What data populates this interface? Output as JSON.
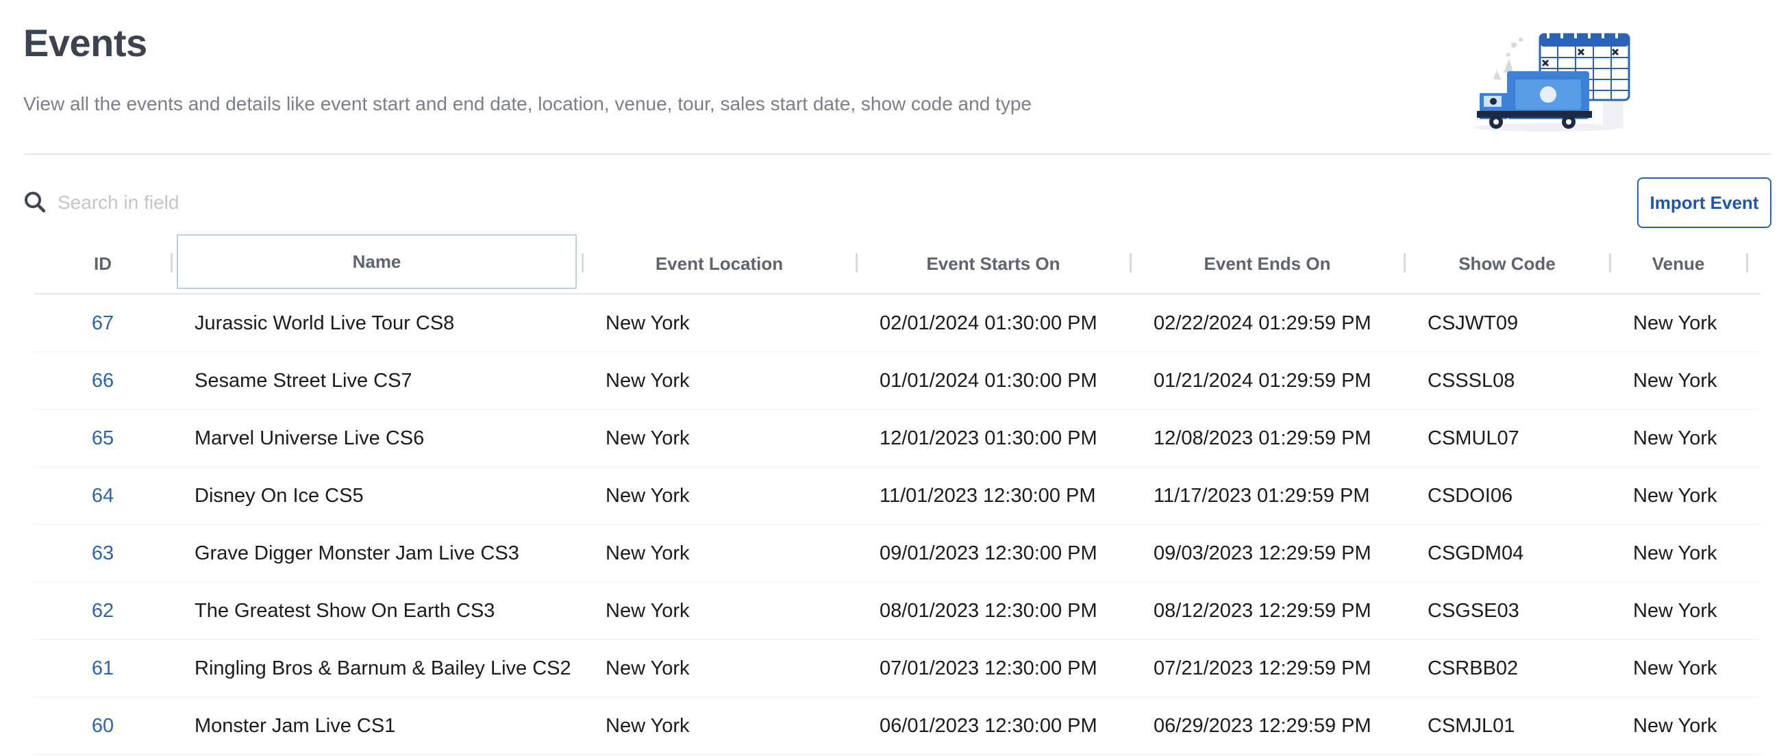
{
  "header": {
    "title": "Events",
    "subtitle": "View all the events and details like event start and end date, location, venue, tour, sales start date, show code and type"
  },
  "search": {
    "placeholder": "Search in field",
    "value": ""
  },
  "toolbar": {
    "import_label": "Import Event"
  },
  "colors": {
    "accent": "#2563b8",
    "link": "#2a62b4",
    "heading": "#3c4350"
  },
  "table": {
    "columns": [
      "ID",
      "Name",
      "Event Location",
      "Event Starts On",
      "Event Ends On",
      "Show Code",
      "Venue"
    ],
    "rows": [
      [
        "67",
        "Jurassic World Live Tour CS8",
        "New York",
        "02/01/2024 01:30:00 PM",
        "02/22/2024 01:29:59 PM",
        "CSJWT09",
        "New York"
      ],
      [
        "66",
        "Sesame Street Live CS7",
        "New York",
        "01/01/2024 01:30:00 PM",
        "01/21/2024 01:29:59 PM",
        "CSSSL08",
        "New York"
      ],
      [
        "65",
        "Marvel Universe Live CS6",
        "New York",
        "12/01/2023 01:30:00 PM",
        "12/08/2023 01:29:59 PM",
        "CSMUL07",
        "New York"
      ],
      [
        "64",
        "Disney On Ice CS5",
        "New York",
        "11/01/2023 12:30:00 PM",
        "11/17/2023 01:29:59 PM",
        "CSDOI06",
        "New York"
      ],
      [
        "63",
        "Grave Digger Monster Jam Live CS3",
        "New York",
        "09/01/2023 12:30:00 PM",
        "09/03/2023 12:29:59 PM",
        "CSGDM04",
        "New York"
      ],
      [
        "62",
        "The Greatest Show On Earth CS3",
        "New York",
        "08/01/2023 12:30:00 PM",
        "08/12/2023 12:29:59 PM",
        "CSGSE03",
        "New York"
      ],
      [
        "61",
        "Ringling Bros & Barnum & Bailey Live CS2",
        "New York",
        "07/01/2023 12:30:00 PM",
        "07/21/2023 12:29:59 PM",
        "CSRBB02",
        "New York"
      ],
      [
        "60",
        "Monster Jam Live CS1",
        "New York",
        "06/01/2023 12:30:00 PM",
        "06/29/2023 12:29:59 PM",
        "CSMJL01",
        "New York"
      ]
    ]
  }
}
